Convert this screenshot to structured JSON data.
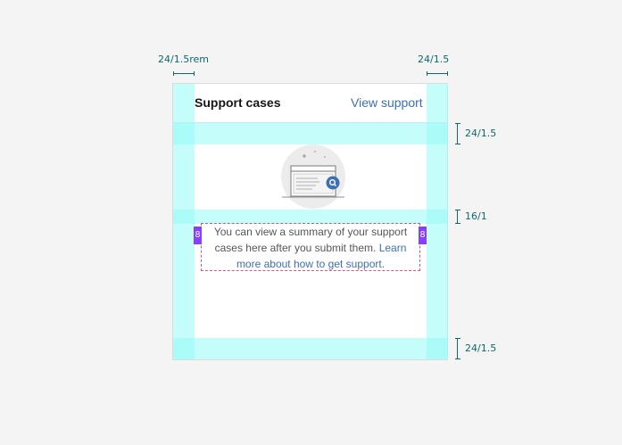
{
  "annotations": {
    "left_padding": "24/1.5rem",
    "right_padding": "24/1.5",
    "header_gap": "24/1.5",
    "image_gap": "16/1",
    "bottom_padding": "24/1.5"
  },
  "card": {
    "title": "Support cases",
    "link_label": "View support",
    "message_text": "You can view a summary of your support cases here after you submit them.",
    "message_link": "Learn more about how to get support.",
    "spacing_tag": "8"
  },
  "colors": {
    "padding_highlight": "#96fcf8",
    "link": "#3d70b2",
    "spacing_tag": "#8a3ffc",
    "annotation": "#0e6a6a"
  },
  "icons": {
    "illustration": "support-window-search-icon"
  }
}
